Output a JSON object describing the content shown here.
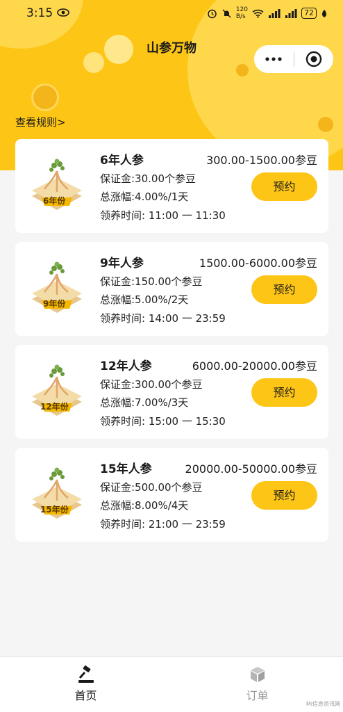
{
  "status_bar": {
    "time": "3:15",
    "net_speed_top": "120",
    "net_speed_bottom": "B/s",
    "battery": "72"
  },
  "header": {
    "title": "山参万物",
    "rules_link": "查看规则>"
  },
  "products": [
    {
      "name": "6年人参",
      "price_range": "300.00-1500.00参豆",
      "deposit": "保证金:30.00个参豆",
      "growth": "总涨幅:4.00%/1天",
      "time": "领养时间: 11:00 一 11:30",
      "badge": "6年份",
      "button": "预约"
    },
    {
      "name": "9年人参",
      "price_range": "1500.00-6000.00参豆",
      "deposit": "保证金:150.00个参豆",
      "growth": "总涨幅:5.00%/2天",
      "time": "领养时间: 14:00 一 23:59",
      "badge": "9年份",
      "button": "预约"
    },
    {
      "name": "12年人参",
      "price_range": "6000.00-20000.00参豆",
      "deposit": "保证金:300.00个参豆",
      "growth": "总涨幅:7.00%/3天",
      "time": "领养时间: 15:00 一 15:30",
      "badge": "12年份",
      "button": "预约"
    },
    {
      "name": "15年人参",
      "price_range": "20000.00-50000.00参豆",
      "deposit": "保证金:500.00个参豆",
      "growth": "总涨幅:8.00%/4天",
      "time": "领养时间: 21:00 一 23:59",
      "badge": "15年份",
      "button": "预约"
    }
  ],
  "tabbar": {
    "home": "首页",
    "orders": "订单"
  },
  "watermark": "Mi信息资讯网",
  "colors": {
    "accent": "#fdc515",
    "background": "#f5f5f5"
  }
}
